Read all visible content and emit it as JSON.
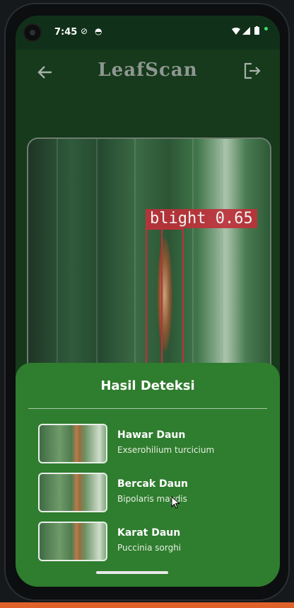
{
  "status_bar": {
    "time": "7:45",
    "icons": [
      "do-not-disturb-icon",
      "cloud-icon",
      "wifi-icon",
      "signal-icon",
      "battery-icon"
    ]
  },
  "app_bar": {
    "title": "LeafScan",
    "back_icon": "arrow-back-icon",
    "logout_icon": "logout-icon"
  },
  "detection": {
    "label": "blight 0.65",
    "box_color": "#c0303a"
  },
  "results": {
    "title": "Hasil Deteksi",
    "items": [
      {
        "name": "Hawar Daun",
        "latin": "Exserohilium turcicium"
      },
      {
        "name": "Bercak Daun",
        "latin": "Bipolaris maydis"
      },
      {
        "name": "Karat Daun",
        "latin": "Puccinia sorghi"
      }
    ]
  },
  "colors": {
    "background": "#163a1b",
    "sheet": "#2f7d2e",
    "accent": "#c0303a"
  }
}
